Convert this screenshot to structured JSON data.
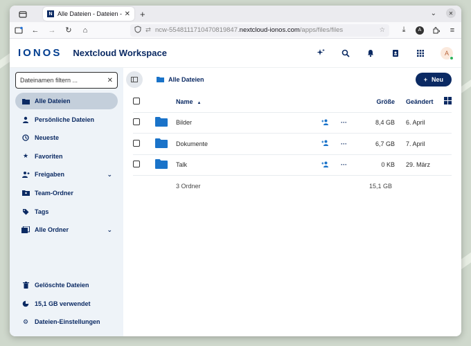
{
  "browser": {
    "tab_title": "Alle Dateien - Dateien - IONOS",
    "tab_favicon": "N",
    "tab_close": "✕",
    "new_tab": "+",
    "url_prefix": "ncw-5548111710470819847.",
    "url_domain": "nextcloud-ionos.com",
    "url_path": "/apps/files/files",
    "account_initial": "A"
  },
  "app": {
    "logo": "IONOS",
    "name": "Nextcloud Workspace",
    "avatar_initial": "A"
  },
  "sidebar": {
    "filter_placeholder": "Dateinamen filtern ...",
    "items": [
      {
        "label": "Alle Dateien",
        "icon": "folder-icon",
        "active": true
      },
      {
        "label": "Persönliche Dateien",
        "icon": "person-icon"
      },
      {
        "label": "Neueste",
        "icon": "history-icon"
      },
      {
        "label": "Favoriten",
        "icon": "star-icon"
      },
      {
        "label": "Freigaben",
        "icon": "share-icon",
        "expandable": true
      },
      {
        "label": "Team-Ordner",
        "icon": "team-folder-icon"
      },
      {
        "label": "Tags",
        "icon": "tag-icon"
      },
      {
        "label": "Alle Ordner",
        "icon": "folders-icon",
        "expandable": true
      }
    ],
    "bottom_items": [
      {
        "label": "Gelöschte Dateien",
        "icon": "trash-icon"
      },
      {
        "label": "15,1 GB verwendet",
        "icon": "pie-chart-icon"
      },
      {
        "label": "Dateien-Einstellungen",
        "icon": "gear-icon"
      }
    ]
  },
  "main": {
    "breadcrumb": "Alle Dateien",
    "new_button": "Neu",
    "columns": {
      "name": "Name",
      "size": "Größe",
      "modified": "Geändert"
    },
    "files": [
      {
        "name": "Bilder",
        "size": "8,4 GB",
        "modified": "6. April"
      },
      {
        "name": "Dokumente",
        "size": "6,7 GB",
        "modified": "7. April"
      },
      {
        "name": "Talk",
        "size": "0 KB",
        "modified": "29. März"
      }
    ],
    "summary": {
      "count": "3 Ordner",
      "size": "15,1 GB"
    }
  },
  "colors": {
    "brand": "#0b2a63",
    "folder": "#1a73c9",
    "sidebar_bg": "#eef3f8",
    "active_item": "#c4cfdb"
  }
}
